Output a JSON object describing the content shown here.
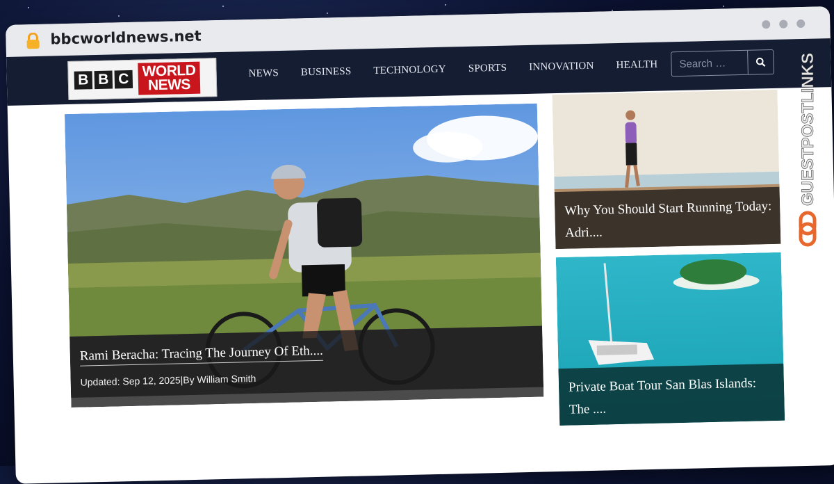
{
  "browser": {
    "url": "bbcworldnews.net"
  },
  "site": {
    "logo_left": [
      "B",
      "B",
      "C"
    ],
    "logo_right_line1": "WORLD",
    "logo_right_line2": "NEWS",
    "nav": [
      "NEWS",
      "BUSINESS",
      "TECHNOLOGY",
      "SPORTS",
      "INNOVATION",
      "HEALTH"
    ],
    "search_placeholder": "Search …"
  },
  "hero": {
    "title": "Rami Beracha: Tracing The Journey Of Eth....",
    "meta": "Updated: Sep 12, 2025|By William Smith"
  },
  "side_cards": [
    {
      "title": "Why You Should Start Running Today: Adri...."
    },
    {
      "title": "Private Boat Tour San Blas Islands: The ...."
    }
  ],
  "watermark": {
    "text": "GUESTPOSTLINKS"
  },
  "colors": {
    "navbar": "#151d33",
    "brand_red": "#c9161d",
    "watermark_orange": "#e8672c"
  }
}
